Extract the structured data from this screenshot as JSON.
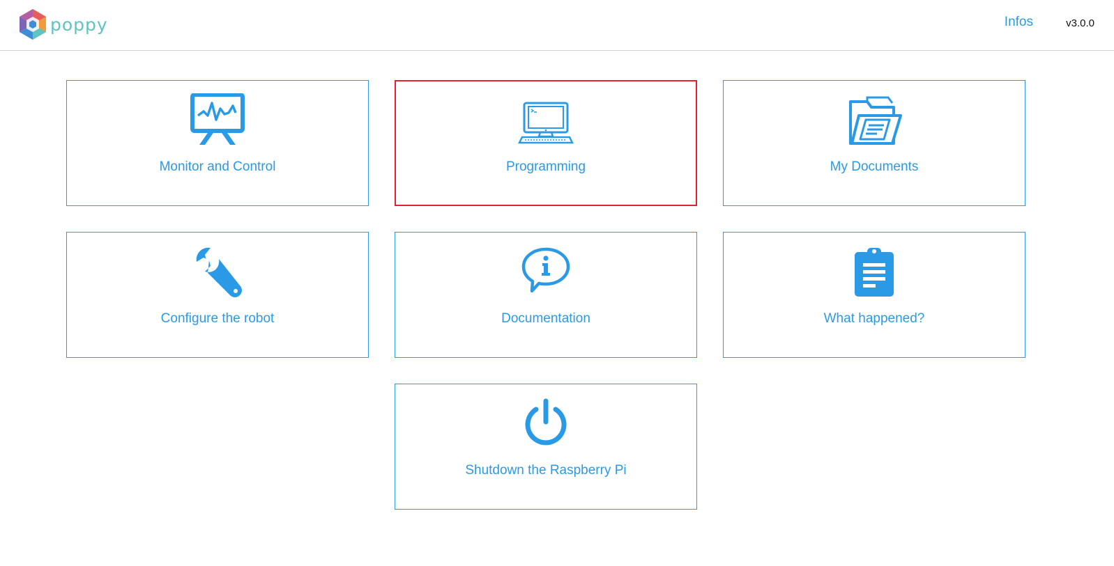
{
  "header": {
    "logo_text": "poppy",
    "infos_label": "Infos",
    "version": "v3.0.0"
  },
  "colors": {
    "accent": "#2a9ae6",
    "selected_border": "#e8202a",
    "logo_teal": "#5fc4c0"
  },
  "tiles": [
    {
      "label": "Monitor and Control",
      "icon": "presentation-chart-icon"
    },
    {
      "label": "Programming",
      "icon": "desktop-computer-icon",
      "selected": true
    },
    {
      "label": "My Documents",
      "icon": "folder-documents-icon"
    },
    {
      "label": "Configure the robot",
      "icon": "wrench-icon"
    },
    {
      "label": "Documentation",
      "icon": "info-speech-bubble-icon"
    },
    {
      "label": "What happened?",
      "icon": "clipboard-icon"
    },
    {
      "label": "Shutdown the Raspberry Pi",
      "icon": "power-icon"
    }
  ]
}
